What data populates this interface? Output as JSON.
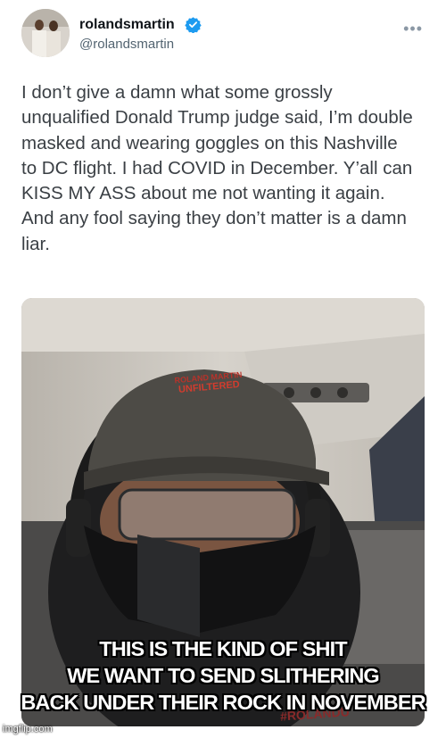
{
  "tweet": {
    "display_name": "rolandsmartin",
    "handle": "@rolandsmartin",
    "verified_icon": "verified-badge-icon",
    "more_icon": "more-options-icon",
    "text": "I don’t give a damn what some grossly unqualified Donald Trump judge said, I’m double masked and wearing goggles on this Nashville to DC flight. I had COVID in December. Y’all can KISS MY ASS about me not wanting it again. And any fool saying they don’t matter is a damn liar."
  },
  "photo": {
    "cap_text_top": "ROLAND MARTIN",
    "cap_text_bottom": "UNFILTERED",
    "shirt_text": "#ROLANDU"
  },
  "caption": {
    "line1": "THIS IS THE KIND OF SHIT",
    "line2": "WE WANT TO SEND SLITHERING",
    "line3": "BACK UNDER THEIR ROCK IN NOVEMBER"
  },
  "watermark": "imgflip.com",
  "colors": {
    "verified": "#1d9bf0",
    "caption_text": "#ffffff",
    "caption_outline": "#000000"
  }
}
